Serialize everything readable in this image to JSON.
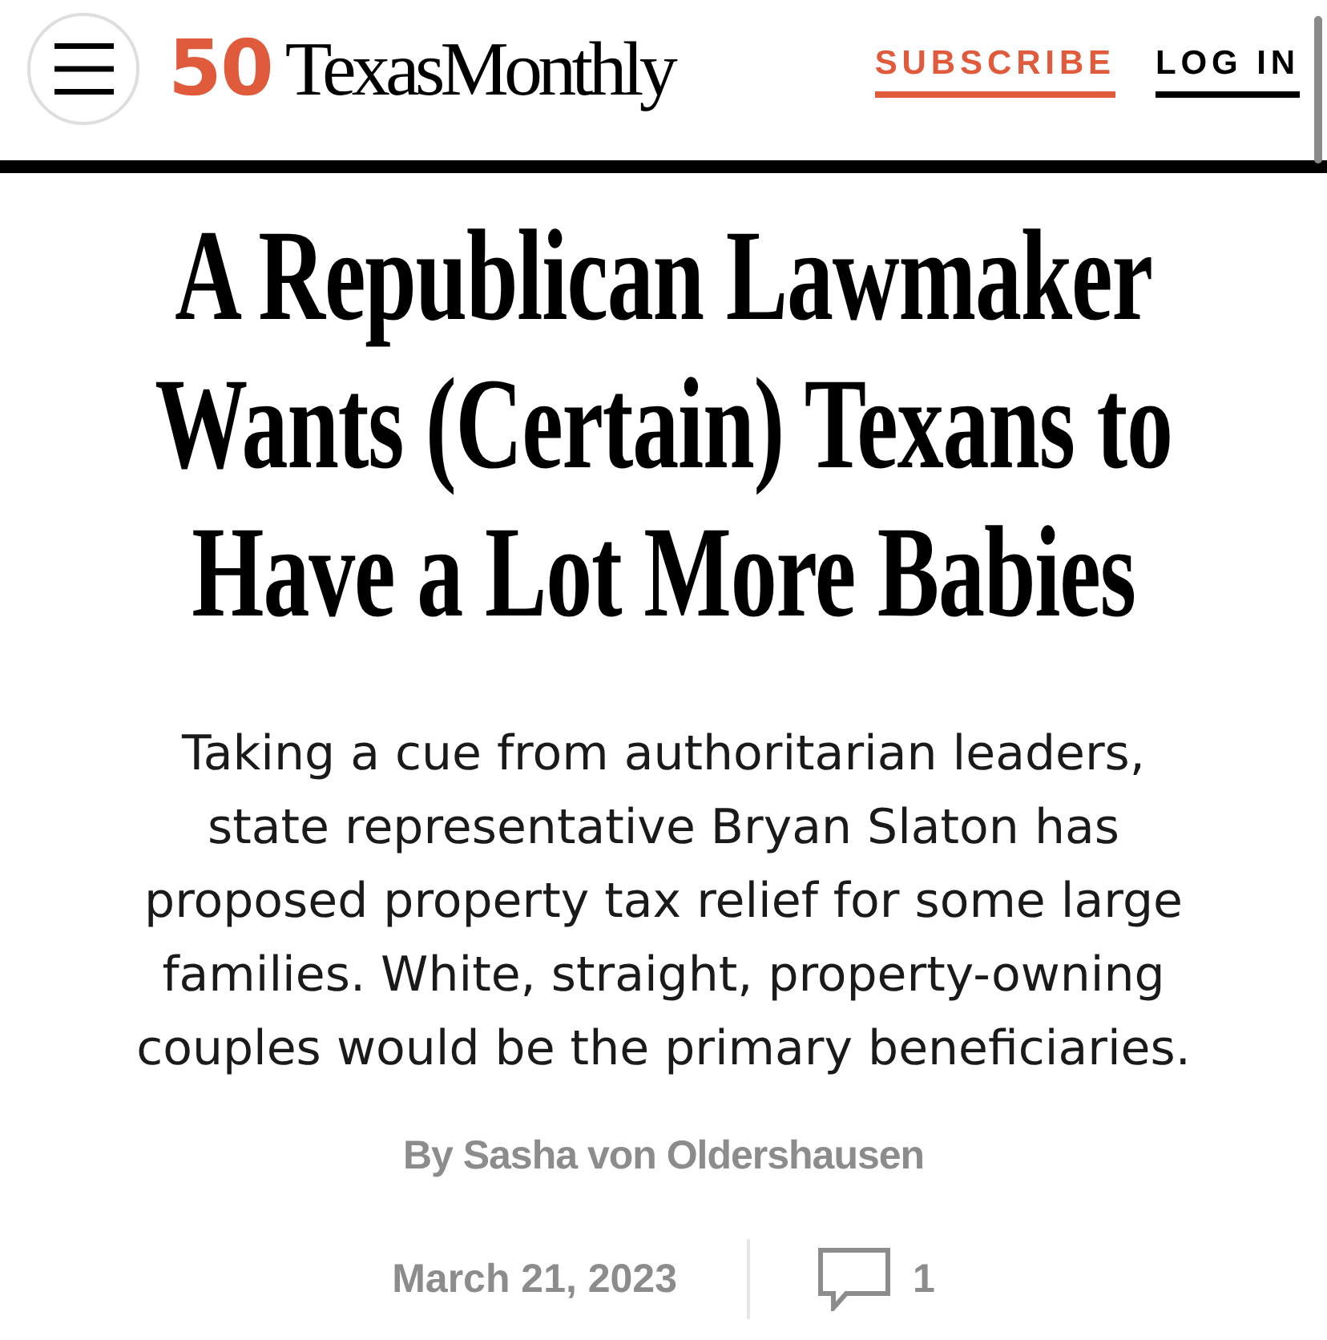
{
  "header": {
    "logo": {
      "badge": "50",
      "wordmark": "TexasMonthly"
    },
    "links": [
      {
        "label": "SUBSCRIBE",
        "kind": "accent"
      },
      {
        "label": "LOG IN",
        "kind": "plain"
      }
    ]
  },
  "article": {
    "headline": "A Republican Lawmaker Wants (Certain) Texans to Have a Lot More Babies",
    "summary": "Taking a cue from authoritarian leaders, state representative Bryan Slaton has proposed property tax relief for some large families. White, straight, property-owning couples would be the primary beneficiaries.",
    "byline": "By Sasha von Oldershausen",
    "date": "March 21, 2023",
    "comment_count": "1"
  }
}
